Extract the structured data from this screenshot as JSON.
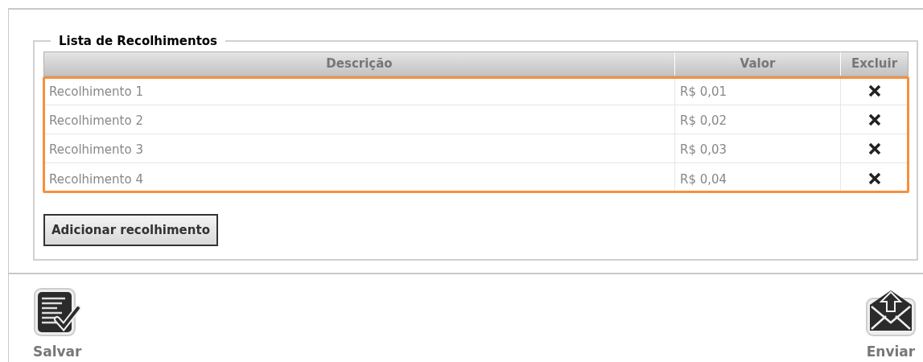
{
  "fieldset": {
    "legend": "Lista de Recolhimentos"
  },
  "table": {
    "columns": [
      "Descrição",
      "Valor",
      "Excluir"
    ],
    "highlighted": true,
    "rows": [
      {
        "description": "Recolhimento 1",
        "value": "R$ 0,01"
      },
      {
        "description": "Recolhimento 2",
        "value": "R$ 0,02"
      },
      {
        "description": "Recolhimento 3",
        "value": "R$ 0,03"
      },
      {
        "description": "Recolhimento 4",
        "value": "R$ 0,04"
      }
    ]
  },
  "add_button": "Adicionar recolhimento",
  "actions": [
    {
      "kind": "save",
      "label": "Salvar"
    },
    {
      "kind": "send",
      "label": "Enviar"
    }
  ]
}
